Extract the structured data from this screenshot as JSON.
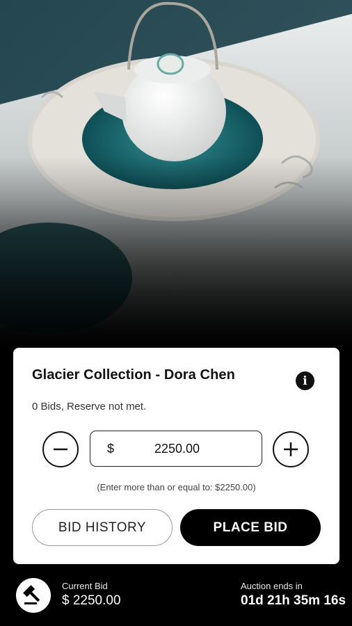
{
  "product": {
    "title": "Glacier Collection - Dora Chen",
    "bids_status": "0 Bids, Reserve not met.",
    "image_description_icon": "teapot-on-plate-image"
  },
  "bid_input": {
    "currency_symbol": "$",
    "amount": "2250.00",
    "hint": "(Enter more than or equal to: $2250.00)"
  },
  "buttons": {
    "bid_history": "BID HISTORY",
    "place_bid": "PLACE BID"
  },
  "footer": {
    "current_bid_label": "Current Bid",
    "current_bid_value": "$ 2250.00",
    "auction_ends_label": "Auction ends in",
    "auction_ends_value": "01d 21h 35m 16s"
  },
  "icons": {
    "info": "info-icon",
    "minus": "minus-icon",
    "plus": "plus-icon",
    "gavel": "gavel-icon"
  },
  "colors": {
    "accent_teal": "#1f6b6e",
    "card_bg": "#ffffff",
    "primary_button": "#000000"
  }
}
